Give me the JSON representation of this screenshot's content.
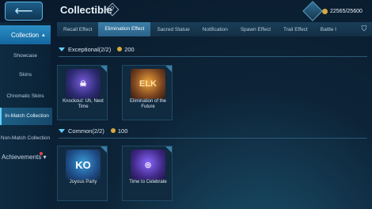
{
  "header": {
    "title": "Collectible",
    "currency_value": "22565/25600"
  },
  "sidebar": {
    "main_label": "Collection",
    "items": [
      {
        "label": "Showcase"
      },
      {
        "label": "Skins"
      },
      {
        "label": "Chromatic Skins"
      },
      {
        "label": "In-Match Collection"
      },
      {
        "label": "Non-Match Collection"
      }
    ],
    "achievements_label": "Achievements"
  },
  "tabs": [
    {
      "label": "Recall Effect"
    },
    {
      "label": "Elimination Effect"
    },
    {
      "label": "Sacred Statue"
    },
    {
      "label": "Notification"
    },
    {
      "label": "Spawn Effect"
    },
    {
      "label": "Trail Effect"
    },
    {
      "label": "Battle I"
    }
  ],
  "sections": [
    {
      "title": "Exceptional(2/2)",
      "points": "200",
      "cards": [
        {
          "caption": "Knockout: Uh, Next Time",
          "badge": "☠"
        },
        {
          "caption": "Elimination of the Future",
          "badge": "ELK"
        }
      ]
    },
    {
      "title": "Common(2/2)",
      "points": "100",
      "cards": [
        {
          "caption": "Joyous Party",
          "badge": "KO"
        },
        {
          "caption": "Time to Celebrate",
          "badge": "◎"
        }
      ]
    }
  ],
  "colors": {
    "accent": "#5fd0ff",
    "active_tab": "#2a6289",
    "coin": "#d9a93c"
  }
}
